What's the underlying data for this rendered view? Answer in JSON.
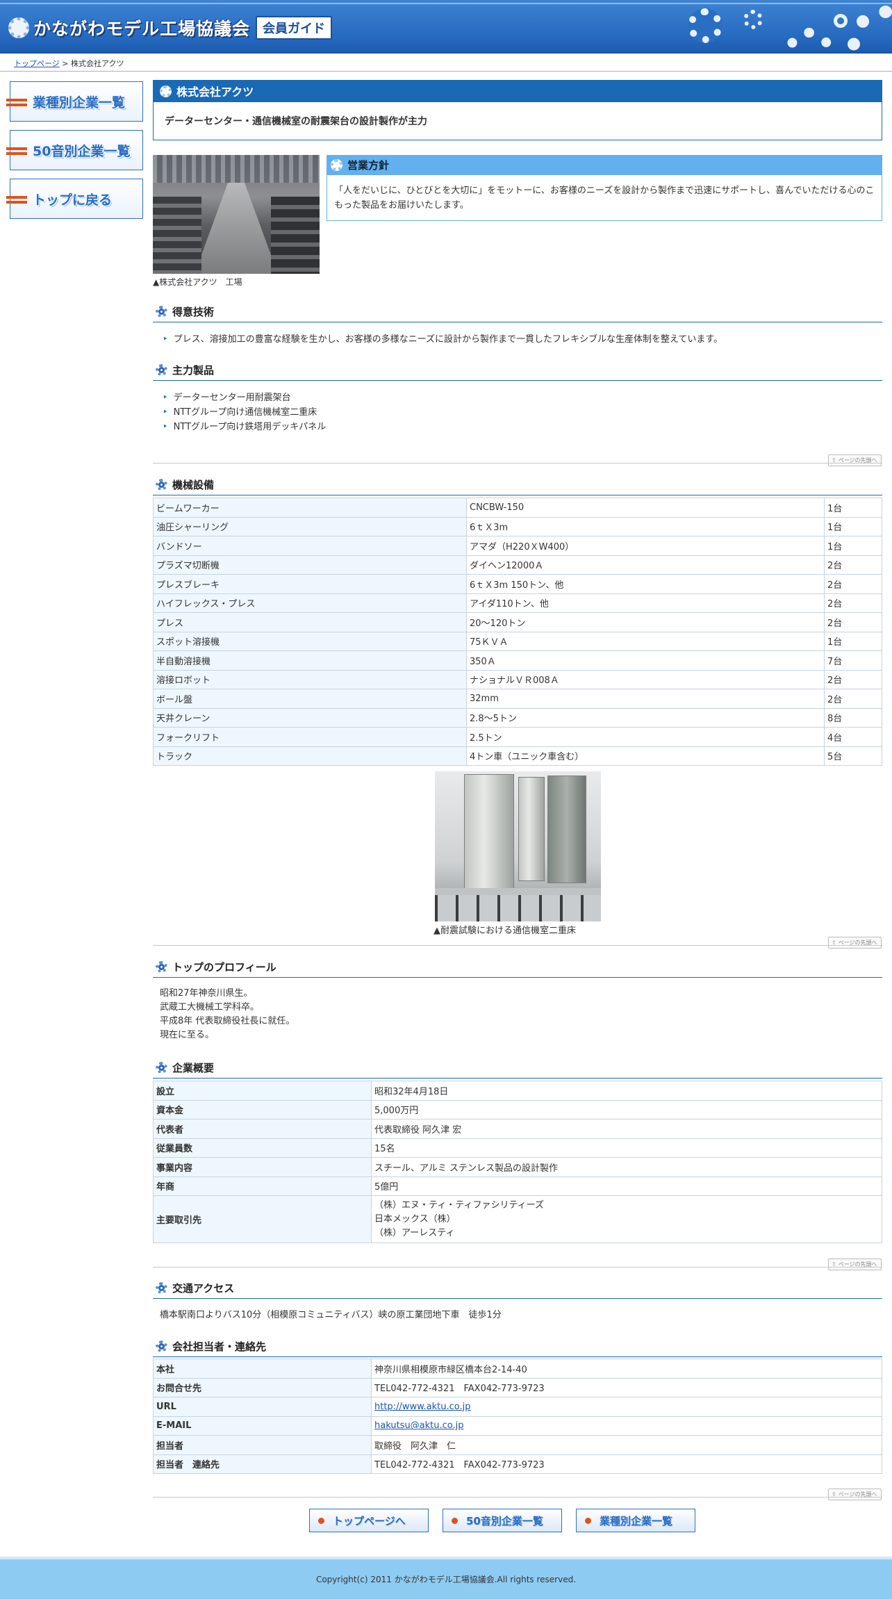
{
  "header": {
    "site_title": "かながわモデル工場協議会",
    "badge": "会員ガイド",
    "logo_icon": "gear-icon"
  },
  "breadcrumb": {
    "home": "トップページ",
    "separator": ">",
    "current": "株式会社アクツ"
  },
  "sidebar": {
    "items": [
      {
        "label": "業種別企業一覧"
      },
      {
        "label": "50音別企業一覧"
      },
      {
        "label": "トップに戻る"
      }
    ]
  },
  "company": {
    "name": "株式会社アクツ",
    "tagline": "データーセンター・通信機械室の耐震架台の設計製作が主力",
    "photo_caption": "▲株式会社アクツ　工場"
  },
  "policy": {
    "heading": "営業方針",
    "text": "「人をだいじに、ひとびとを大切に」をモットーに、お客様のニーズを設計から製作まで迅速にサポートし、喜んでいただける心のこもった製品をお届けいたします。"
  },
  "skills": {
    "heading": "得意技術",
    "items": [
      "プレス、溶接加工の豊富な経験を生かし、お客様の多様なニーズに設計から製作まで一貫したフレキシブルな生産体制を整えています。"
    ]
  },
  "products": {
    "heading": "主力製品",
    "items": [
      "データーセンター用耐震架台",
      "NTTグループ向け通信機械室二重床",
      "NTTグループ向け鉄塔用デッキパネル"
    ]
  },
  "page_top_label": "ページの先頭へ",
  "equipment": {
    "heading": "機械設備",
    "rows": [
      [
        "ビームワーカー",
        "CNCBW-150",
        "1台"
      ],
      [
        "油圧シャーリング",
        "6ｔＸ3m",
        "1台"
      ],
      [
        "バンドソー",
        "アマダ（H220ＸW400）",
        "1台"
      ],
      [
        "プラズマ切断機",
        "ダイヘン12000Ａ",
        "2台"
      ],
      [
        "プレスブレーキ",
        "6ｔＸ3m 150トン、他",
        "2台"
      ],
      [
        "ハイフレックス・プレス",
        "アイダ110トン、他",
        "2台"
      ],
      [
        "プレス",
        "20〜120トン",
        "2台"
      ],
      [
        "スポット溶接機",
        "75ＫＶＡ",
        "1台"
      ],
      [
        "半自動溶接機",
        "350Ａ",
        "7台"
      ],
      [
        "溶接ロボット",
        "ナショナルＶＲ008Ａ",
        "2台"
      ],
      [
        "ボール盤",
        "32mm",
        "2台"
      ],
      [
        "天井クレーン",
        "2.8〜5トン",
        "8台"
      ],
      [
        "フォークリフト",
        "2.5トン",
        "4台"
      ],
      [
        "トラック",
        "4トン車（ユニック車含む）",
        "5台"
      ]
    ],
    "photo_caption": "▲耐震試験における通信機室二重床"
  },
  "profile": {
    "heading": "トップのプロフィール",
    "lines": [
      "昭和27年神奈川県生。",
      "武蔵工大機械工学科卒。",
      "平成8年 代表取締役社長に就任。",
      "現在に至る。"
    ]
  },
  "overview": {
    "heading": "企業概要",
    "rows": [
      {
        "key": "設立",
        "value": "昭和32年4月18日"
      },
      {
        "key": "資本金",
        "value": "5,000万円"
      },
      {
        "key": "代表者",
        "value": "代表取締役 阿久津 宏"
      },
      {
        "key": "従業員数",
        "value": "15名"
      },
      {
        "key": "事業内容",
        "value": "スチール、アルミ ステンレス製品の設計製作"
      },
      {
        "key": "年商",
        "value": "5億円"
      },
      {
        "key": "主要取引先",
        "value_lines": [
          "（株）エヌ・ティ・ティファシリティーズ",
          "日本メックス（株）",
          "（株）アーレスティ"
        ]
      }
    ]
  },
  "access": {
    "heading": "交通アクセス",
    "text": "橋本駅南口よりバス10分（相模原コミュニティバス）峡の原工業団地下車　徒歩1分"
  },
  "contact": {
    "heading": "会社担当者・連絡先",
    "rows": [
      {
        "key": "本社",
        "value": "神奈川県相模原市緑区橋本台2-14-40"
      },
      {
        "key": "お問合せ先",
        "value": "TEL042-772-4321　FAX042-773-9723"
      },
      {
        "key": "URL",
        "value": "http://www.aktu.co.jp",
        "link": true
      },
      {
        "key": "E-MAIL",
        "value": "hakutsu@aktu.co.jp",
        "link": true
      },
      {
        "key": "担当者",
        "value": "取締役　阿久津　仁"
      },
      {
        "key": "担当者　連絡先",
        "value": "TEL042-772-4321　FAX042-773-9723"
      }
    ]
  },
  "bottom_nav": {
    "items": [
      {
        "label": "トップページへ"
      },
      {
        "label": "50音別企業一覧"
      },
      {
        "label": "業種別企業一覧"
      }
    ]
  },
  "footer": {
    "copyright": "Copyright(c) 2011 かながわモデル工場協議会.All rights reserved."
  },
  "colors": {
    "header_blue": "#2a6ec4",
    "title_bar": "#1a69b4",
    "policy_head": "#63b0ee",
    "accent_orange": "#e0521c",
    "table_label_bg": "#eef7fd",
    "footer_bg": "#8ecbf2"
  }
}
